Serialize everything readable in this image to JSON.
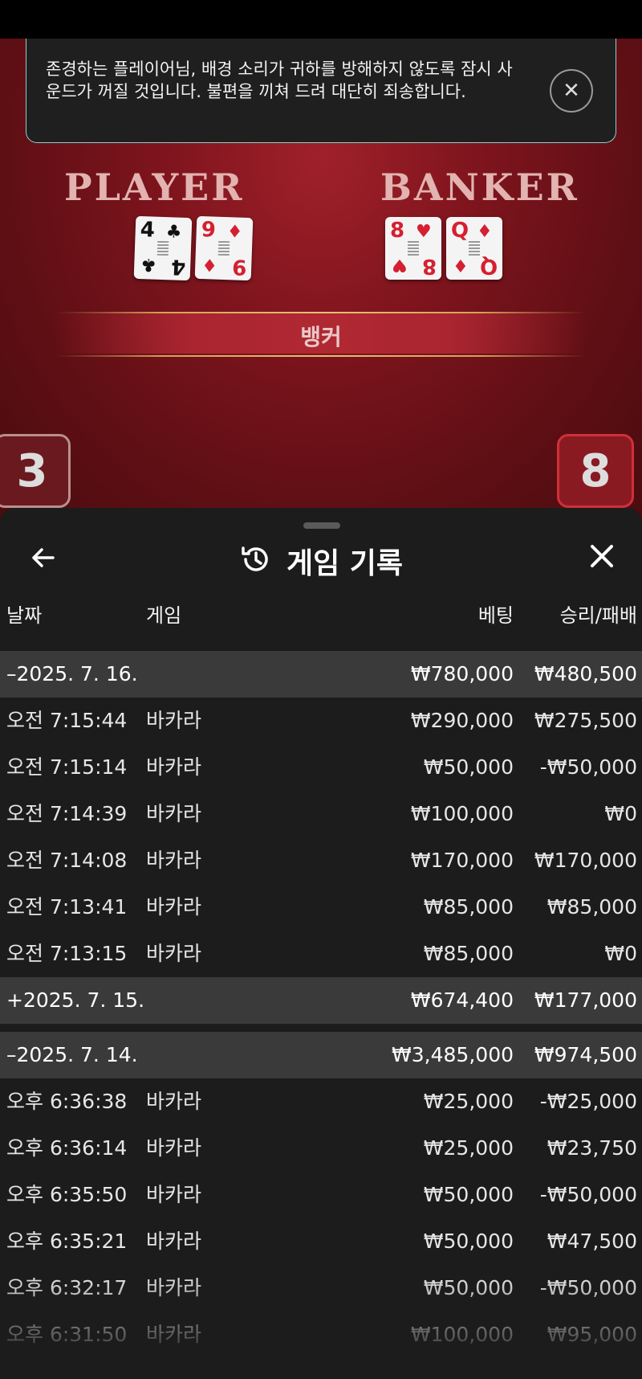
{
  "notice": {
    "text": "존경하는 플레이어님, 배경 소리가 귀하를 방해하지 않도록 잠시 사운드가 꺼질 것입니다. 불편을 끼쳐 드려 대단히 죄송합니다."
  },
  "table": {
    "player_label": "PLAYER",
    "banker_label": "BANKER",
    "player_cards": [
      {
        "rank": "4",
        "suit": "♣",
        "color": "black"
      },
      {
        "rank": "9",
        "suit": "♦",
        "color": "red"
      }
    ],
    "banker_cards": [
      {
        "rank": "8",
        "suit": "♥",
        "color": "red"
      },
      {
        "rank": "Q",
        "suit": "♦",
        "color": "red"
      }
    ],
    "result": "뱅커",
    "player_score": "3",
    "banker_score": "8"
  },
  "history": {
    "title": "게임 기록",
    "columns": {
      "date": "날짜",
      "game": "게임",
      "bet": "베팅",
      "win_loss": "승리/패배"
    },
    "groups": [
      {
        "date": "–2025. 7. 16.",
        "bet": "₩780,000",
        "win": "₩480,500",
        "rows": [
          {
            "time": "오전 7:15:44",
            "game": "바카라",
            "bet": "₩290,000",
            "win": "₩275,500"
          },
          {
            "time": "오전 7:15:14",
            "game": "바카라",
            "bet": "₩50,000",
            "win": "-₩50,000"
          },
          {
            "time": "오전 7:14:39",
            "game": "바카라",
            "bet": "₩100,000",
            "win": "₩0"
          },
          {
            "time": "오전 7:14:08",
            "game": "바카라",
            "bet": "₩170,000",
            "win": "₩170,000"
          },
          {
            "time": "오전 7:13:41",
            "game": "바카라",
            "bet": "₩85,000",
            "win": "₩85,000"
          },
          {
            "time": "오전 7:13:15",
            "game": "바카라",
            "bet": "₩85,000",
            "win": "₩0"
          }
        ]
      },
      {
        "date": "+2025. 7. 15.",
        "bet": "₩674,400",
        "win": "₩177,000",
        "rows": []
      },
      {
        "date": "–2025. 7. 14.",
        "bet": "₩3,485,000",
        "win": "₩974,500",
        "rows": [
          {
            "time": "오후 6:36:38",
            "game": "바카라",
            "bet": "₩25,000",
            "win": "-₩25,000"
          },
          {
            "time": "오후 6:36:14",
            "game": "바카라",
            "bet": "₩25,000",
            "win": "₩23,750"
          },
          {
            "time": "오후 6:35:50",
            "game": "바카라",
            "bet": "₩50,000",
            "win": "-₩50,000"
          },
          {
            "time": "오후 6:35:21",
            "game": "바카라",
            "bet": "₩50,000",
            "win": "₩47,500"
          },
          {
            "time": "오후 6:32:17",
            "game": "바카라",
            "bet": "₩50,000",
            "win": "-₩50,000"
          },
          {
            "time": "오후 6:31:50",
            "game": "바카라",
            "bet": "₩100,000",
            "win": "₩95,000"
          }
        ]
      }
    ]
  }
}
